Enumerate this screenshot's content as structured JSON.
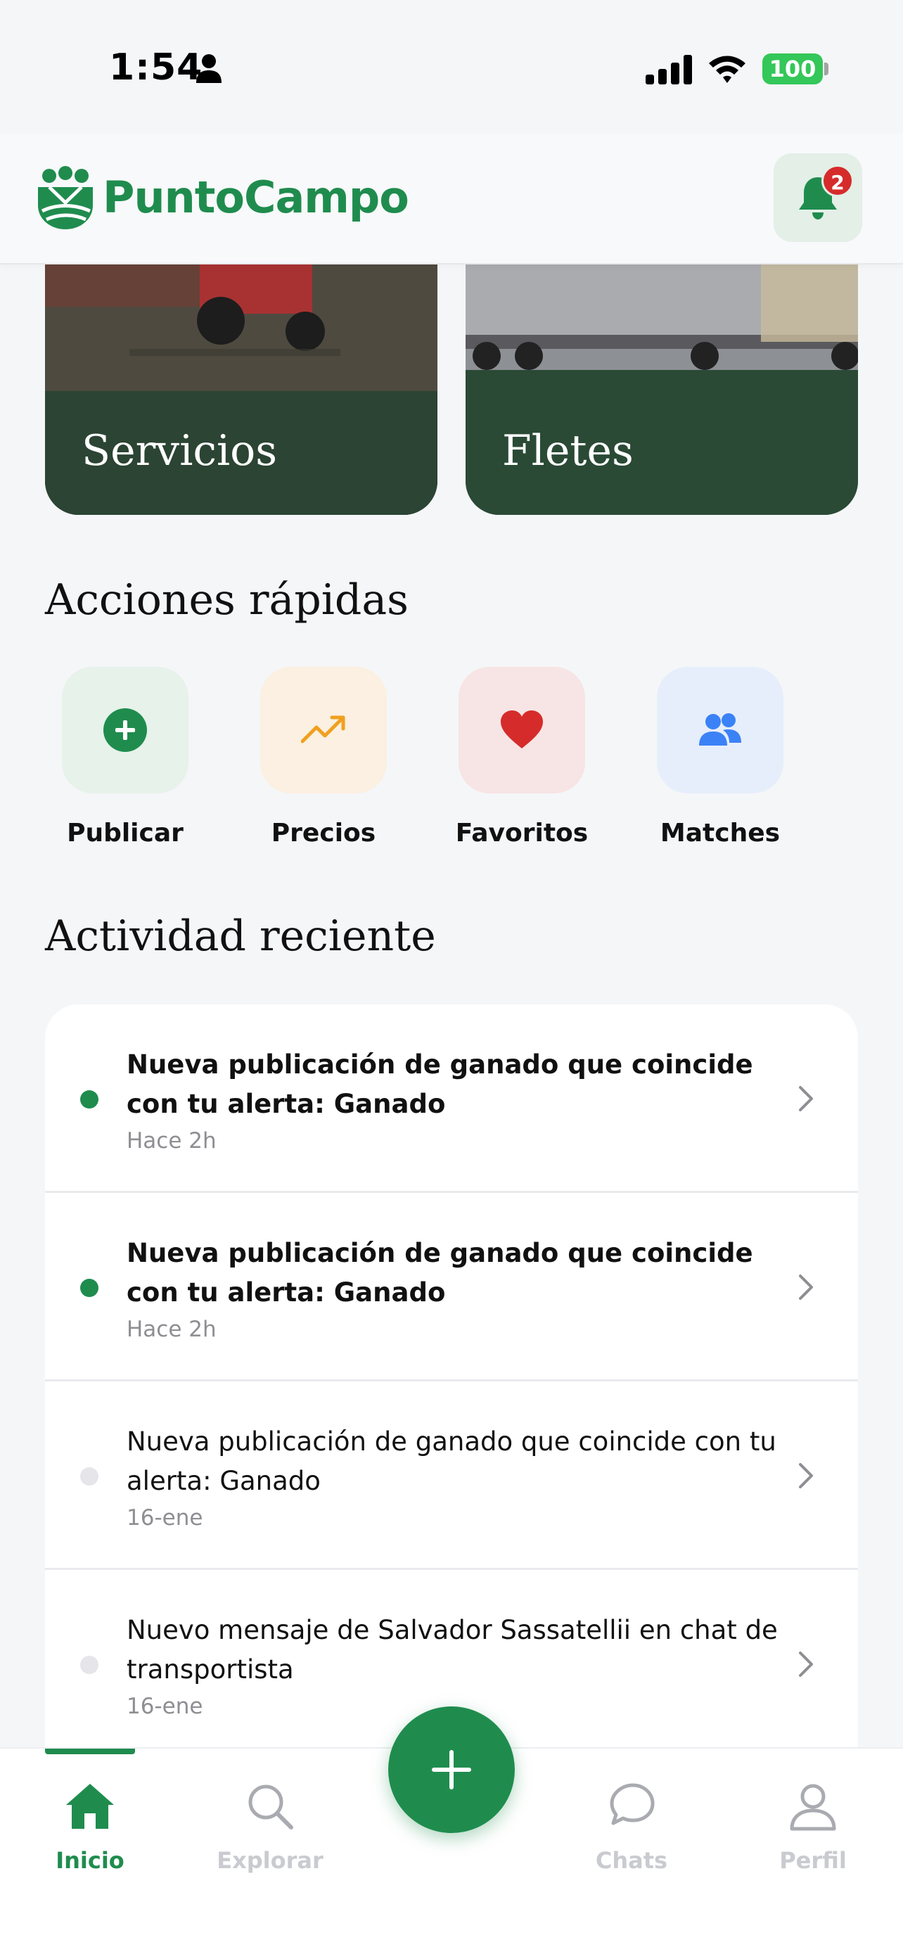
{
  "status_bar": {
    "time": "1:54",
    "battery": "100"
  },
  "header": {
    "brand": "PuntoCampo",
    "notification_count": "2"
  },
  "categories": [
    {
      "label": "Servicios"
    },
    {
      "label": "Fletes"
    }
  ],
  "quick_actions": {
    "title": "Acciones rápidas",
    "items": [
      {
        "label": "Publicar",
        "icon": "plus-circle-icon",
        "bg": "#e6f2ea",
        "color": "#1f8c4e"
      },
      {
        "label": "Precios",
        "icon": "trending-up-icon",
        "bg": "#fbf0e1",
        "color": "#f0a020"
      },
      {
        "label": "Favoritos",
        "icon": "heart-icon",
        "bg": "#f7e4e4",
        "color": "#d62b2b"
      },
      {
        "label": "Matches",
        "icon": "users-icon",
        "bg": "#e6eefb",
        "color": "#3b82f6"
      }
    ]
  },
  "activity": {
    "title": "Actividad reciente",
    "items": [
      {
        "text": "Nueva publicación de ganado que coincide con tu alerta: Ganado",
        "time": "Hace 2h",
        "unread": true
      },
      {
        "text": "Nueva publicación de ganado que coincide con tu alerta: Ganado",
        "time": "Hace 2h",
        "unread": true
      },
      {
        "text": "Nueva publicación de ganado que coincide con tu alerta: Ganado",
        "time": "16-ene",
        "unread": false
      },
      {
        "text": "Nuevo mensaje de Salvador Sassatellii en chat de transportista",
        "time": "16-ene",
        "unread": false
      }
    ]
  },
  "bottom_nav": {
    "items": [
      {
        "label": "Inicio",
        "icon": "home-icon",
        "active": true
      },
      {
        "label": "Explorar",
        "icon": "search-icon",
        "active": false
      },
      {
        "label": "Chats",
        "icon": "chat-icon",
        "active": false
      },
      {
        "label": "Perfil",
        "icon": "user-icon",
        "active": false
      }
    ]
  },
  "colors": {
    "brand": "#1f8c4e",
    "unread_dot": "#1f8c4e",
    "read_dot": "#e5e5ea",
    "badge": "#d62b2b"
  }
}
